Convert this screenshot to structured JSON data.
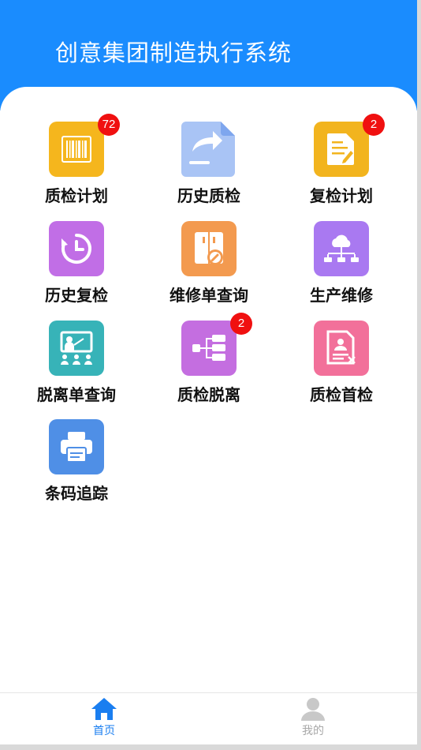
{
  "header": {
    "title": "创意集团制造执行系统"
  },
  "grid": {
    "items": [
      {
        "label": "质检计划",
        "badge": "72",
        "color": "#f5b61d",
        "icon": "barcode-icon"
      },
      {
        "label": "历史质检",
        "badge": "",
        "color": "#a9c4f5",
        "icon": "share-file-icon"
      },
      {
        "label": "复检计划",
        "badge": "2",
        "color": "#f2b41e",
        "icon": "document-edit-icon"
      },
      {
        "label": "历史复检",
        "badge": "",
        "color": "#c16ee6",
        "icon": "clock-history-icon"
      },
      {
        "label": "维修单查询",
        "badge": "",
        "color": "#f39a4f",
        "icon": "cabinet-wrench-icon"
      },
      {
        "label": "生产维修",
        "badge": "",
        "color": "#a979f1",
        "icon": "network-cloud-icon"
      },
      {
        "label": "脱离单查询",
        "badge": "",
        "color": "#37b3b8",
        "icon": "presentation-icon"
      },
      {
        "label": "质检脱离",
        "badge": "2",
        "color": "#c46ee0",
        "icon": "flow-diagram-icon"
      },
      {
        "label": "质检首检",
        "badge": "",
        "color": "#f2709a",
        "icon": "id-document-icon"
      },
      {
        "label": "条码追踪",
        "badge": "",
        "color": "#4f8fe6",
        "icon": "printer-icon"
      }
    ]
  },
  "tabbar": {
    "home": {
      "label": "首页",
      "icon": "home-icon",
      "color": "#1a7ef0"
    },
    "mine": {
      "label": "我的",
      "icon": "user-icon",
      "color": "#c8c8c8"
    }
  }
}
